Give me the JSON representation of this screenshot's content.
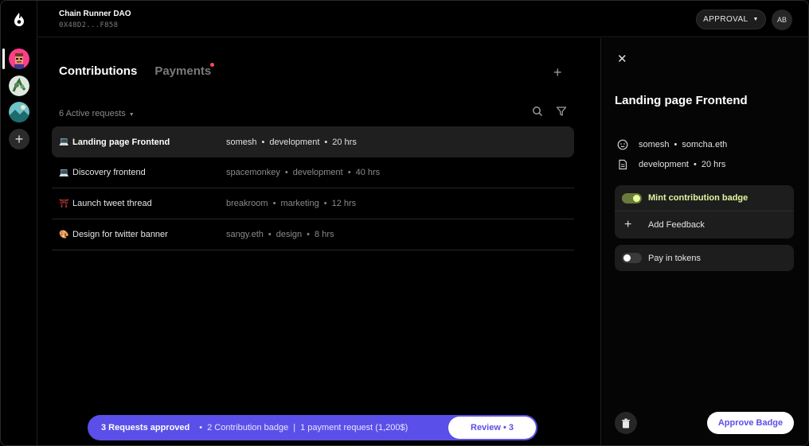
{
  "topbar": {
    "dao_name": "Chain Runner DAO",
    "dao_address": "0X48D2...F858",
    "approval_label": "APPROVAL",
    "user_initials": "AB"
  },
  "rail": {
    "logo_icon": "flame-drop-icon",
    "daos": [
      {
        "icon": "dao-avatar-1",
        "active": true
      },
      {
        "icon": "dao-avatar-2",
        "active": false
      },
      {
        "icon": "dao-avatar-3",
        "active": false
      }
    ],
    "add_label": "+"
  },
  "main": {
    "tabs": [
      {
        "label": "Contributions",
        "active": true
      },
      {
        "label": "Payments",
        "active": false,
        "notification": true
      }
    ],
    "add_label": "+",
    "active_requests_label": "6 Active requests",
    "requests": [
      {
        "emoji": "💻",
        "title": "Landing page Frontend",
        "user": "somesh",
        "category": "development",
        "hours": "20 hrs",
        "selected": true
      },
      {
        "emoji": "💻",
        "title": "Discovery frontend",
        "user": "spacemonkey",
        "category": "development",
        "hours": "40 hrs",
        "selected": false
      },
      {
        "emoji": "⛩",
        "title": "Launch tweet thread",
        "user": "breakroom",
        "category": "marketing",
        "hours": "12 hrs",
        "selected": false
      },
      {
        "emoji": "🎨",
        "title": "Design for twitter banner",
        "user": "sangy.eth",
        "category": "design",
        "hours": "8 hrs",
        "selected": false
      }
    ],
    "banner": {
      "approved": "3 Requests approved",
      "badges": "2 Contribution badge",
      "payments": "1 payment request (1,200$)",
      "review_label": "Review • 3"
    }
  },
  "panel": {
    "close_label": "✕",
    "title": "Landing page Frontend",
    "user": "somesh",
    "ens": "somcha.eth",
    "category": "development",
    "hours": "20 hrs",
    "mint_badge_label": "Mint contribution badge",
    "mint_badge_on": true,
    "add_feedback_label": "Add Feedback",
    "pay_tokens_label": "Pay in tokens",
    "pay_tokens_on": false,
    "approve_label": "Approve Badge"
  },
  "colors": {
    "accent": "#5a4fe8",
    "toggle_on": "#dff7a0",
    "notification": "#ff4b4b"
  }
}
